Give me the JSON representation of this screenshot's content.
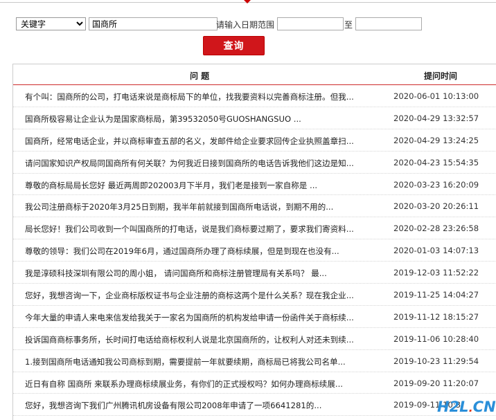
{
  "search": {
    "type_selected": "关键字",
    "keyword_value": "国商所",
    "date_label": "请输入日期范围",
    "date_from": "",
    "to_label": "至",
    "date_to": "",
    "submit_label": "查询"
  },
  "table": {
    "col_question": "问 题",
    "col_time": "提问时间",
    "rows": [
      {
        "q": "有个叫：国商所的公司，打电话来说是商标局下的单位，找我要资料以完善商标注册。但我...",
        "t": "2020-06-01 10:13:00"
      },
      {
        "q": "国商所极容易让企业认为是国家商标局，第39532050号GUOSHANGSUO ...",
        "t": "2020-04-29 13:32:57"
      },
      {
        "q": "国商所，经常电话企业，并以商标审查五部的名义，发邮件给企业要求回传企业执照盖章扫...",
        "t": "2020-04-29 13:24:25"
      },
      {
        "q": "请问国家知识产权局同国商所有何关联？为何我近日接到国商所的电话告诉我他们这边是知...",
        "t": "2020-04-23 15:54:35"
      },
      {
        "q": "尊敬的商标局局长您好 最近两周即202003月下半月，我们老是接到一家自称是 ...",
        "t": "2020-03-23 16:20:09"
      },
      {
        "q": "我公司注册商标于2020年3月25日到期，我半年前就接到国商所电话说，到期不用的...",
        "t": "2020-03-20 20:26:11"
      },
      {
        "q": "局长您好！我们公司收到一个叫国商所的打电话，说是我们商标要过期了，要求我们寄资料...",
        "t": "2020-02-28 23:26:58"
      },
      {
        "q": "尊敬的领导：我们公司在2019年6月，通过国商所办理了商标续展，但是到现在也没有...",
        "t": "2020-01-03 14:07:13"
      },
      {
        "q": "我是淳硕科技深圳有限公司的周小姐， 请问国商所和商标注册管理局有关系吗？ 最...",
        "t": "2019-12-03 11:52:22"
      },
      {
        "q": "您好，我想咨询一下，企业商标版权证书与企业注册的商标这两个是什么关系？现在我企业...",
        "t": "2019-11-25 14:04:27"
      },
      {
        "q": "今年大量的申请人来电来信发给我关于一家名为国商所的机构发给申请一份函件关于商标续...",
        "t": "2019-11-12 18:15:27"
      },
      {
        "q": "投诉国商商标事务所，长时间打电话给商标权利人说是北京国商所的，让权利人对还未到续...",
        "t": "2019-11-06 10:28:40"
      },
      {
        "q": "1.接到国商所电话通知我公司商标到期，需要提前一年就要续期，商标局已将我公司名单...",
        "t": "2019-10-23 11:29:54"
      },
      {
        "q": "近日有自称 国商所 来联系办理商标续展业务，有你们的正式授权吗？如何办理商标续展...",
        "t": "2019-09-20 11:20:07"
      },
      {
        "q": "您好，我想咨询下我们广州腾讯机房设备有限公司2008年申请了一项6641281的...",
        "t": "2019-09-11 10:3"
      }
    ]
  },
  "watermark": {
    "part1": "H2L",
    "part2": ".",
    "part3": "CN"
  },
  "colors": {
    "accent": "#d0161b",
    "watermark_blue": "#2a8fd9",
    "watermark_red": "#e23b1e"
  }
}
